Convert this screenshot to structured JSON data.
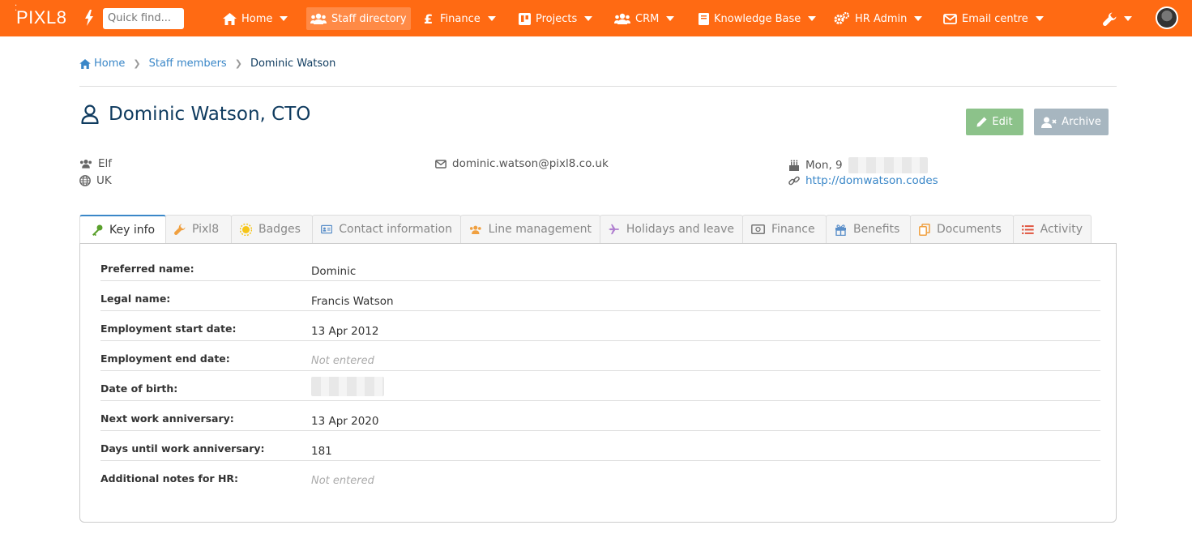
{
  "nav": {
    "logo": "PIXL8",
    "quick_find_placeholder": "Quick find...",
    "items": [
      {
        "label": "Home",
        "icon": "home-icon",
        "dropdown": true
      },
      {
        "label": "Staff directory",
        "icon": "users-icon",
        "dropdown": false,
        "active": true
      },
      {
        "label": "Finance",
        "icon": "pound-icon",
        "dropdown": true
      },
      {
        "label": "Projects",
        "icon": "trello-icon",
        "dropdown": true
      },
      {
        "label": "CRM",
        "icon": "users-icon",
        "dropdown": true
      },
      {
        "label": "Knowledge Base",
        "icon": "book-icon",
        "dropdown": true
      },
      {
        "label": "HR Admin",
        "icon": "cogs-icon",
        "dropdown": true
      },
      {
        "label": "Email centre",
        "icon": "envelope-icon",
        "dropdown": true
      }
    ],
    "tools_icon": "wrench-icon",
    "accent": "#ff6a13"
  },
  "breadcrumb": {
    "home": "Home",
    "staff": "Staff members",
    "current": "Dominic Watson"
  },
  "page": {
    "title": "Dominic Watson, CTO",
    "edit_label": "Edit",
    "archive_label": "Archive"
  },
  "meta": {
    "team": "Elf",
    "country": "UK",
    "email": "dominic.watson@pixl8.co.uk",
    "birthday": "Mon, 9",
    "website": "http://domwatson.codes"
  },
  "tabs": [
    {
      "label": "Key info",
      "icon": "key-icon",
      "active": true
    },
    {
      "label": "Pixl8",
      "icon": "wrench-icon"
    },
    {
      "label": "Badges",
      "icon": "sun-icon"
    },
    {
      "label": "Contact information",
      "icon": "id-card-icon"
    },
    {
      "label": "Line management",
      "icon": "users-icon"
    },
    {
      "label": "Holidays and leave",
      "icon": "plane-icon"
    },
    {
      "label": "Finance",
      "icon": "money-icon"
    },
    {
      "label": "Benefits",
      "icon": "gift-icon"
    },
    {
      "label": "Documents",
      "icon": "copy-icon"
    },
    {
      "label": "Activity",
      "icon": "list-icon"
    }
  ],
  "key_info": {
    "rows": [
      {
        "label": "Preferred name:",
        "value": "Dominic"
      },
      {
        "label": "Legal name:",
        "value": "Francis Watson"
      },
      {
        "label": "Employment start date:",
        "value": "13 Apr 2012"
      },
      {
        "label": "Employment end date:",
        "value": "Not entered"
      },
      {
        "label": "Date of birth:",
        "value": ""
      },
      {
        "label": "Next work anniversary:",
        "value": "13 Apr 2020"
      },
      {
        "label": "Days until work anniversary:",
        "value": "181"
      },
      {
        "label": "Additional notes for HR:",
        "value": "Not entered"
      }
    ]
  }
}
